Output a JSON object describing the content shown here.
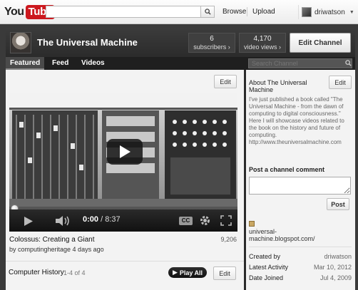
{
  "masthead": {
    "logo_you": "You",
    "logo_tube": "Tube",
    "search_value": "",
    "browse_label": "Browse",
    "upload_label": "Upload",
    "username": "driwatson"
  },
  "channel": {
    "title": "The Universal Machine",
    "subscribers_count": "6",
    "subscribers_label": "subscribers ›",
    "video_views_count": "4,170",
    "video_views_label": "video views ›",
    "edit_channel_label": "Edit Channel",
    "tabs": [
      {
        "label": "Featured",
        "active": true
      },
      {
        "label": "Feed",
        "active": false
      },
      {
        "label": "Videos",
        "active": false
      }
    ],
    "search_placeholder": "Search Channel"
  },
  "featured": {
    "edit_label": "Edit",
    "player": {
      "current_time": "0:00",
      "duration": "8:37",
      "separator": "/",
      "cc_label": "CC"
    },
    "video_title": "Colossus: Creating a Giant",
    "view_count": "9,206",
    "byline": "by computingheritage 4 days ago",
    "playlist_title": "Computer History",
    "playlist_count": "1-4 of 4",
    "play_all_label": "Play All",
    "playlist_edit_label": "Edit"
  },
  "sidebar": {
    "about_title": "About The Universal Machine",
    "edit_label": "Edit",
    "about_text": "I've just published a book called \"The Universal Machine - from the dawn of computing to digital consciousness.\" Here I will showcase videos related to the book on the history and future of computing. http://www.theuniversalmachine.com",
    "comment_label": "Post a channel comment",
    "post_label": "Post",
    "blog_link": "universal-machine.blogspot.com/",
    "info": [
      {
        "label": "Created by",
        "value": "driwatson"
      },
      {
        "label": "Latest Activity",
        "value": "Mar 10, 2012"
      },
      {
        "label": "Date Joined",
        "value": "Jul 4, 2009"
      }
    ]
  },
  "colors": {
    "youtube_red": "#cc181e",
    "channel_background": "#2b2b2b",
    "panel_background": "#f3f3f3"
  },
  "icons": [
    "search-icon",
    "play-icon",
    "volume-icon",
    "settings-gear-icon",
    "fullscreen-icon",
    "caret-down-icon"
  ]
}
